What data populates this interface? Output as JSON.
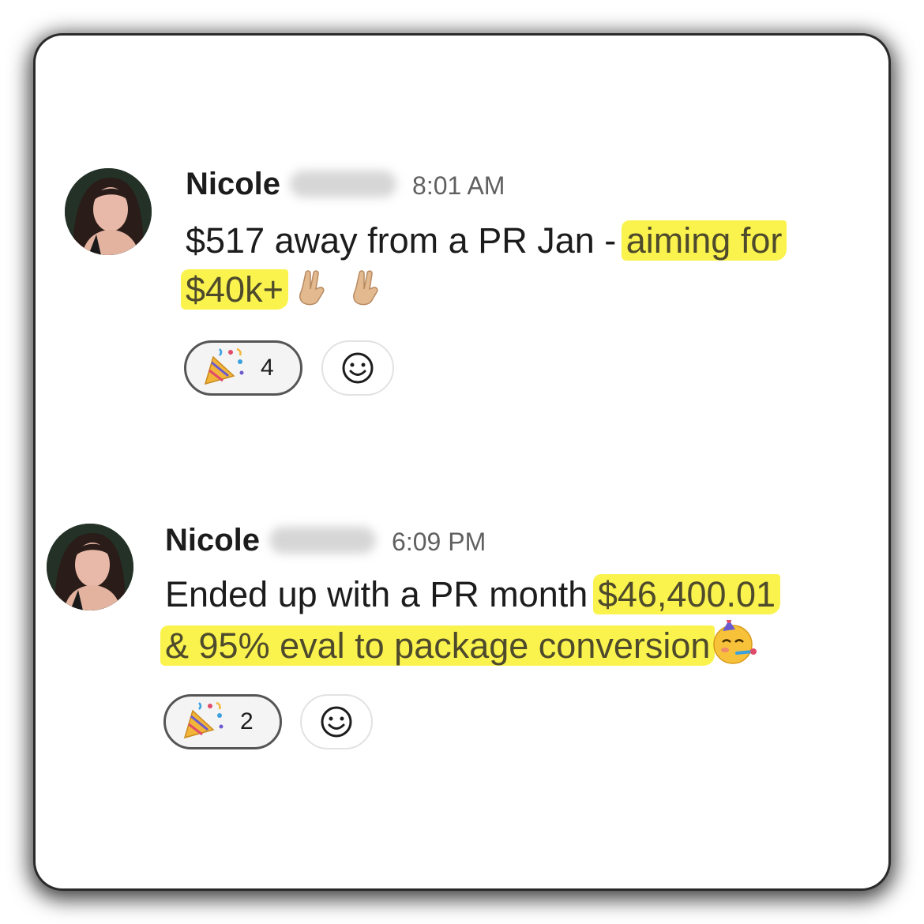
{
  "messages": [
    {
      "author": "Nicole",
      "time": "8:01 AM",
      "line1_plain": "$517 away from a PR Jan - ",
      "line1_highlight": "aiming for",
      "line2_highlight": "$40k+",
      "reaction": {
        "emoji": "party-popper-icon",
        "count": "4"
      }
    },
    {
      "author": "Nicole",
      "time": "6:09 PM",
      "line1_plain": "Ended up with a PR month ",
      "line1_highlight": "$46,400.01",
      "line2_highlight": "& 95% eval to package conversion",
      "reaction": {
        "emoji": "party-popper-icon",
        "count": "2"
      }
    }
  ],
  "colors": {
    "highlight": "#fbf34d",
    "text": "#1d1c1d",
    "timestamp": "#616061",
    "reaction_border": "#555555"
  }
}
